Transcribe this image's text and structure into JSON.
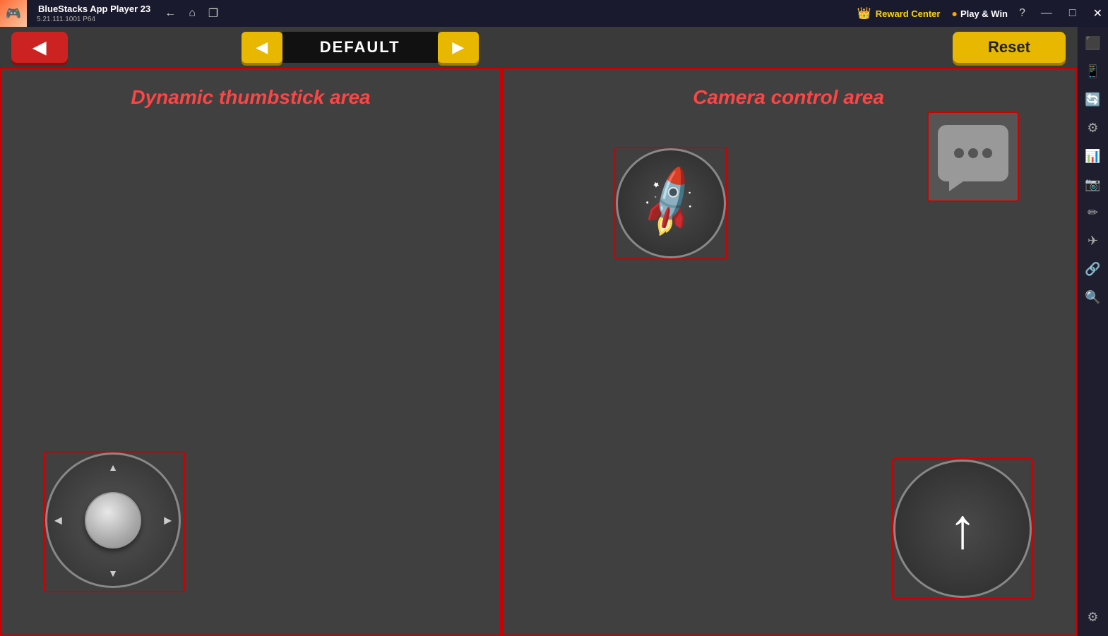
{
  "titlebar": {
    "app_name": "BlueStacks App Player 23",
    "version": "5.21.111.1001 P64",
    "logo": "🎮",
    "reward_center_label": "Reward Center",
    "play_win_label": "Play & Win",
    "nav_back_icon": "←",
    "nav_home_icon": "⌂",
    "nav_copy_icon": "❐",
    "help_icon": "?",
    "minimize_icon": "—",
    "maximize_icon": "□",
    "close_icon": "✕"
  },
  "toolbar": {
    "back_label": "◀",
    "profile_prev_label": "◀",
    "profile_name": "DEFAULT",
    "profile_next_label": "▶",
    "reset_label": "Reset"
  },
  "left_panel": {
    "title": "Dynamic thumbstick area"
  },
  "right_panel": {
    "title": "Camera control area"
  },
  "sidebar": {
    "icons": [
      "⬛",
      "📱",
      "🔄",
      "⚙",
      "📊",
      "📷",
      "✏",
      "✈",
      "🔗",
      "🔍",
      "⚙"
    ]
  }
}
